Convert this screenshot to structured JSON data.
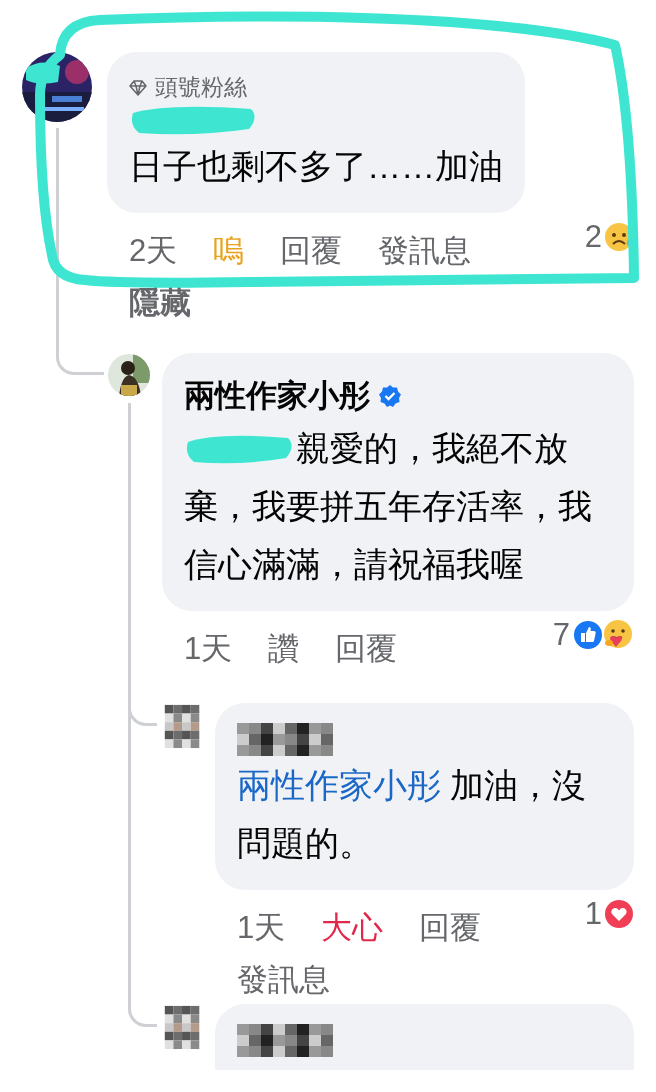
{
  "comments": [
    {
      "author": {
        "kind": "marker"
      },
      "badge": "頭號粉絲",
      "text": "日子也剩不多了……加油",
      "time": "2天",
      "like": {
        "label": "嗚",
        "kind": "sad"
      },
      "actions": [
        "回覆",
        "發訊息"
      ],
      "hide": "隱藏",
      "reaction_count": "2",
      "reactions": [
        {
          "kind": "sad"
        }
      ],
      "replies": [
        {
          "author": {
            "kind": "name",
            "text": "兩性作家小彤",
            "verified": true
          },
          "mention": {
            "kind": "marker"
          },
          "text": "親愛的，我絕不放棄，我要拼五年存活率，我信心滿滿，請祝福我喔",
          "time": "1天",
          "like": {
            "label": "讚",
            "kind": "none"
          },
          "actions": [
            "回覆"
          ],
          "reaction_count": "7",
          "reactions": [
            {
              "kind": "like"
            },
            {
              "kind": "care"
            }
          ],
          "replies": [
            {
              "author": {
                "kind": "mosaic"
              },
              "mention": {
                "kind": "name",
                "text": "兩性作家小彤"
              },
              "text": " 加油，沒問題的。",
              "time": "1天",
              "like": {
                "label": "大心",
                "kind": "love"
              },
              "actions": [
                "回覆",
                "發訊息"
              ],
              "reaction_count": "1",
              "reactions": [
                {
                  "kind": "love"
                }
              ]
            },
            {
              "author": {
                "kind": "mosaic"
              }
            }
          ]
        }
      ]
    }
  ],
  "annotations": [
    {
      "kind": "outline"
    }
  ]
}
